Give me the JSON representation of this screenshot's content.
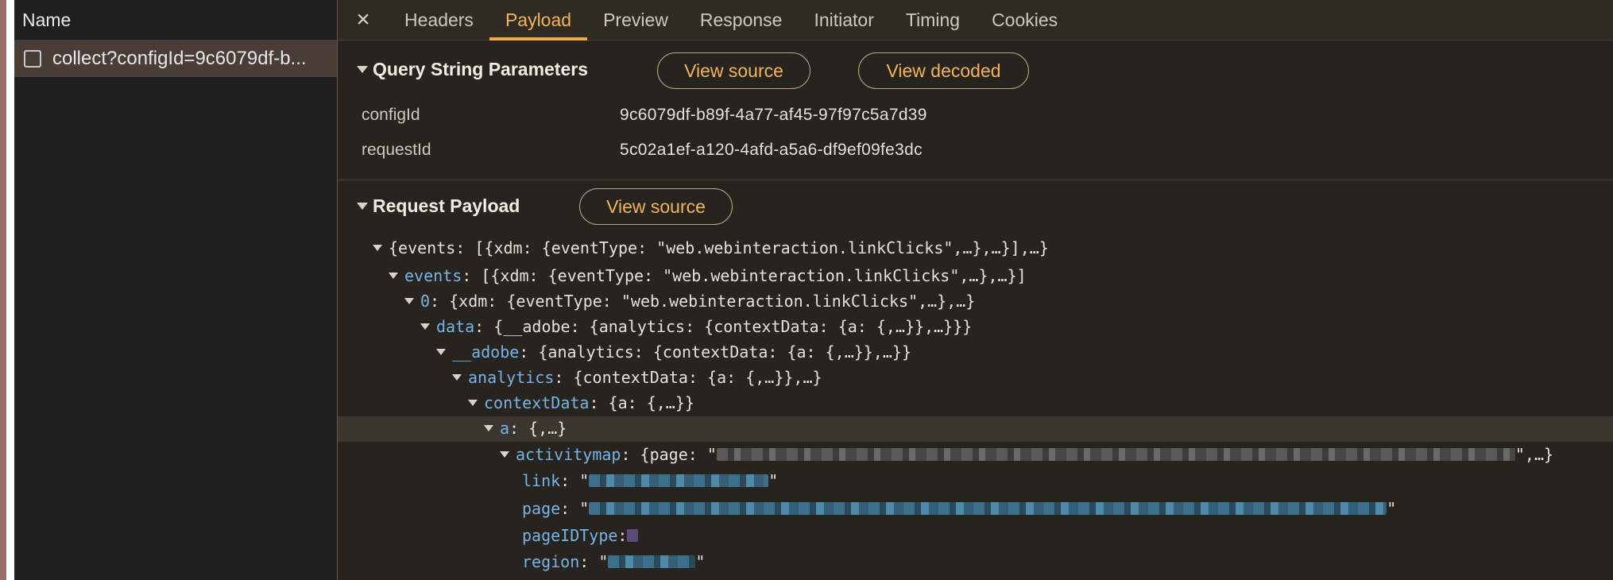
{
  "name_panel": {
    "header": "Name",
    "request_name": "collect?configId=9c6079df-b..."
  },
  "tabs": {
    "close_icon": "×",
    "items": [
      "Headers",
      "Payload",
      "Preview",
      "Response",
      "Initiator",
      "Timing",
      "Cookies"
    ],
    "active": "Payload"
  },
  "query": {
    "title": "Query String Parameters",
    "view_source": "View source",
    "view_decoded": "View decoded",
    "params": [
      {
        "key": "configId",
        "value": "9c6079df-b89f-4a77-af45-97f97c5a7d39"
      },
      {
        "key": "requestId",
        "value": "5c02a1ef-a120-4afd-a5a6-df9ef09fe3dc"
      }
    ]
  },
  "payload": {
    "title": "Request Payload",
    "view_source": "View source",
    "tree": [
      {
        "key": "",
        "value": "{events: [{xdm: {eventType: \"web.webinteraction.linkClicks\",…},…}],…}"
      },
      {
        "key": "events",
        "value": ": [{xdm: {eventType: \"web.webinteraction.linkClicks\",…},…}]"
      },
      {
        "key": "0",
        "value": ": {xdm: {eventType: \"web.webinteraction.linkClicks\",…},…}"
      },
      {
        "key": "data",
        "value": ": {__adobe: {analytics: {contextData: {a: {,…}},…}}}"
      },
      {
        "key": "__adobe",
        "value": ": {analytics: {contextData: {a: {,…}},…}}"
      },
      {
        "key": "analytics",
        "value": ": {contextData: {a: {,…}},…}"
      },
      {
        "key": "contextData",
        "value": ": {a: {,…}}"
      },
      {
        "key": "a",
        "value": ": {,…}"
      },
      {
        "key": "activitymap",
        "value_prefix": ": {page: \"",
        "value_suffix": "\",…}"
      },
      {
        "key": "link",
        "value_prefix": ": \"",
        "value_suffix": "\""
      },
      {
        "key": "page",
        "value_prefix": ": \"",
        "value_suffix": "\""
      },
      {
        "key": "pageIDType",
        "value_prefix": ": "
      },
      {
        "key": "region",
        "value_prefix": ": \"",
        "value_suffix": "\""
      }
    ]
  },
  "colors": {
    "accent": "#f3b35a",
    "key_blue": "#78b3e6",
    "panel_bg": "#272420"
  }
}
